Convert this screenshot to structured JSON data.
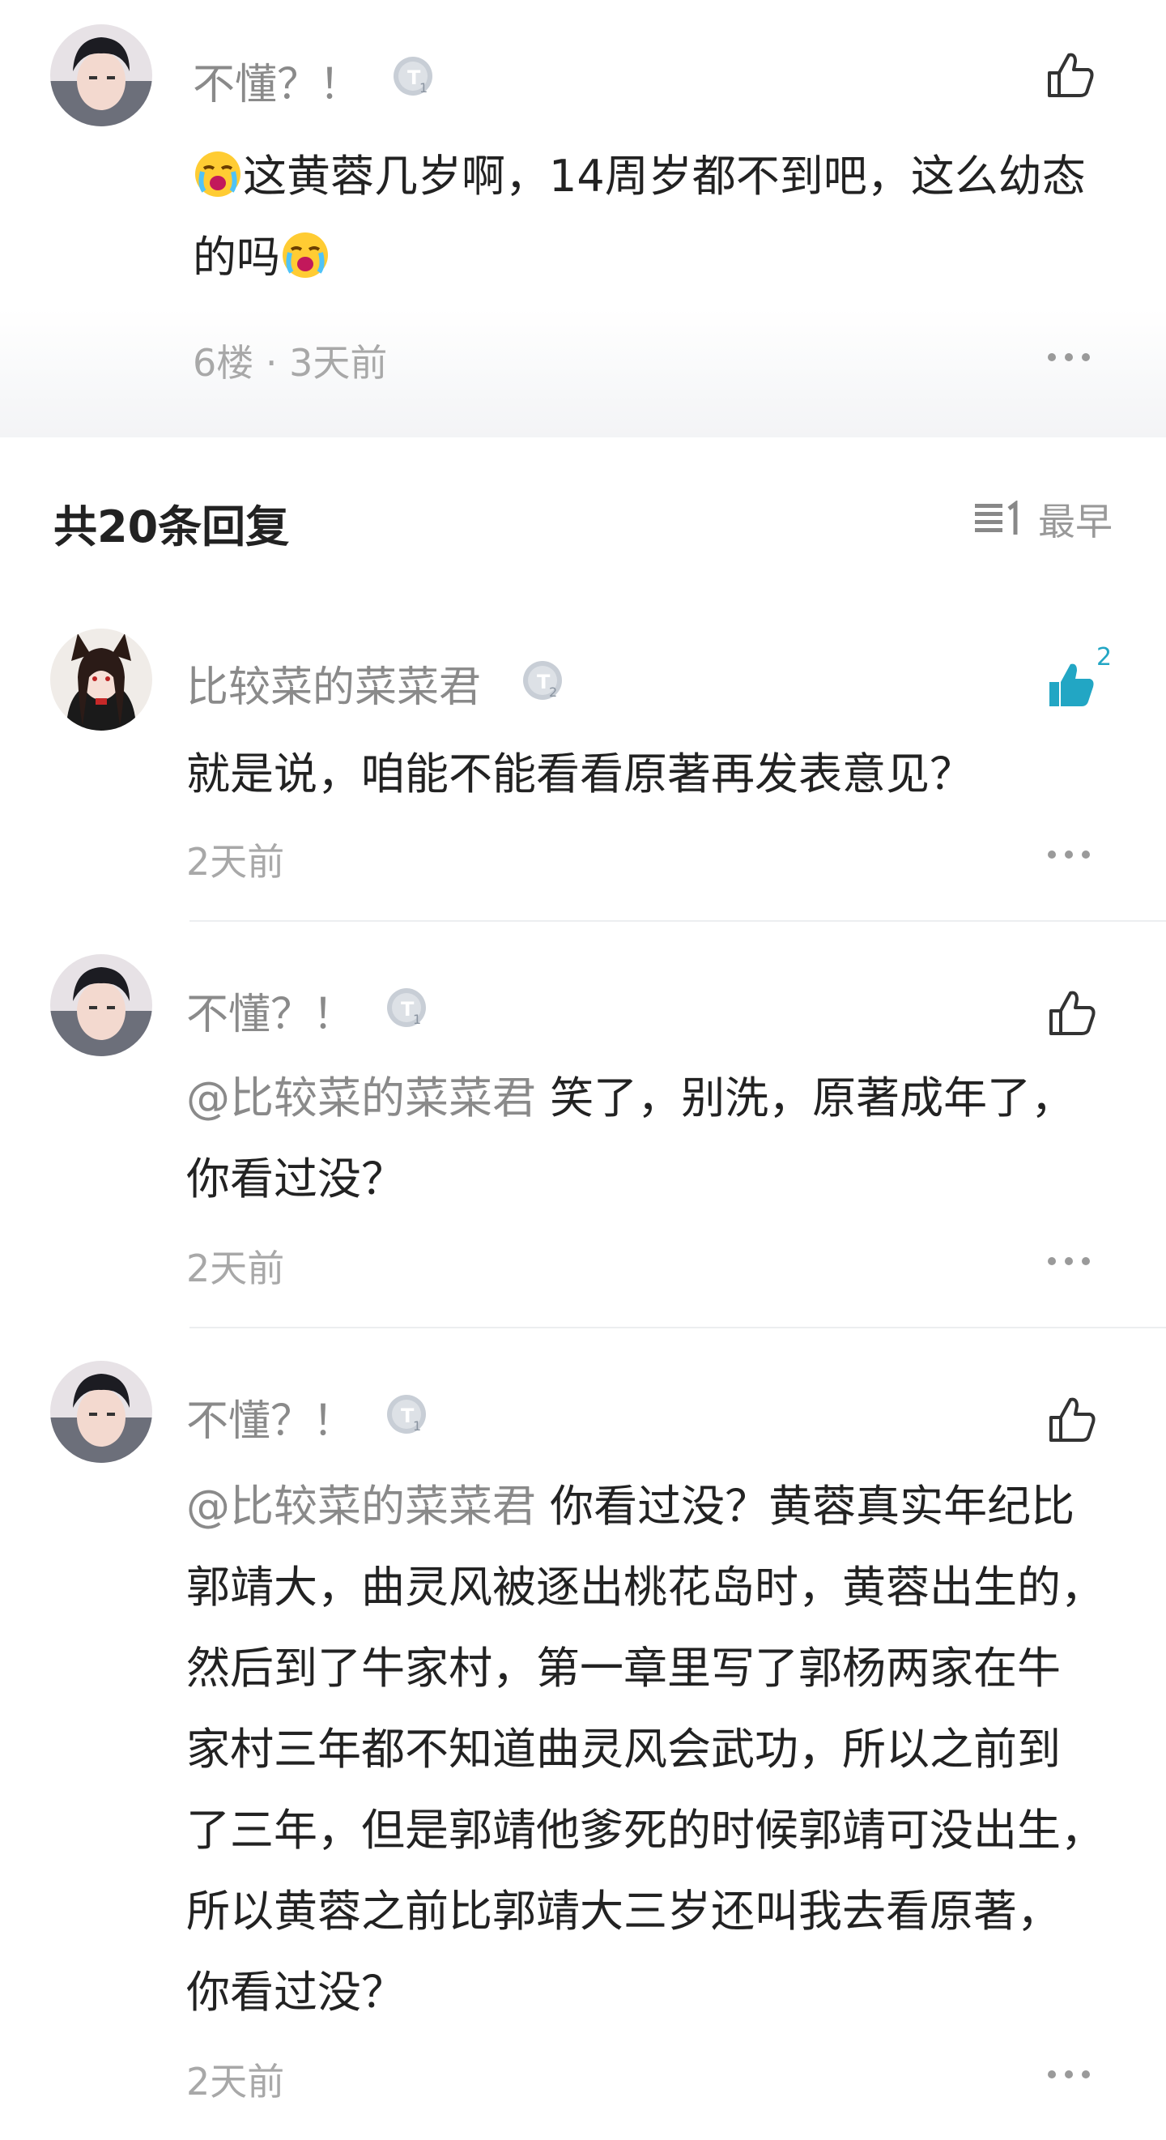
{
  "top_comment": {
    "username": "不懂？！",
    "level": "1",
    "text_part1": "这黄蓉几岁啊，14周岁都不到吧，这么幼态",
    "text_part2": "的吗",
    "meta": "6楼 · 3天前"
  },
  "replies_header": {
    "title": "共20条回复",
    "sort_label": "最早"
  },
  "replies": [
    {
      "username": "比较菜的菜菜君",
      "level": "2",
      "text": "就是说，咱能不能看看原著再发表意见？",
      "time": "2天前",
      "likes": "2"
    },
    {
      "username": "不懂？！",
      "level": "1",
      "mention": "@比较菜的菜菜君",
      "text_line1": "笑了，别洗，原著成年了，",
      "text_line2": "你看过没？",
      "time": "2天前"
    },
    {
      "username": "不懂？！",
      "level": "1",
      "mention": "@比较菜的菜菜君",
      "text_line1": "你看过没？黄蓉真实年纪比",
      "lines": [
        "郭靖大，曲灵风被逐出桃花岛时，黄蓉出生的，",
        "然后到了牛家村，第一章里写了郭杨两家在牛",
        "家村三年都不知道曲灵风会武功，所以之前到",
        "了三年，但是郭靖他爹死的时候郭靖可没出生，",
        "所以黄蓉之前比郭靖大三岁还叫我去看原著，",
        "你看过没？"
      ],
      "time": "2天前"
    }
  ],
  "colors": {
    "accent": "#22a6c4",
    "gray_text": "#8a8a8a",
    "divider": "#eceef0"
  }
}
